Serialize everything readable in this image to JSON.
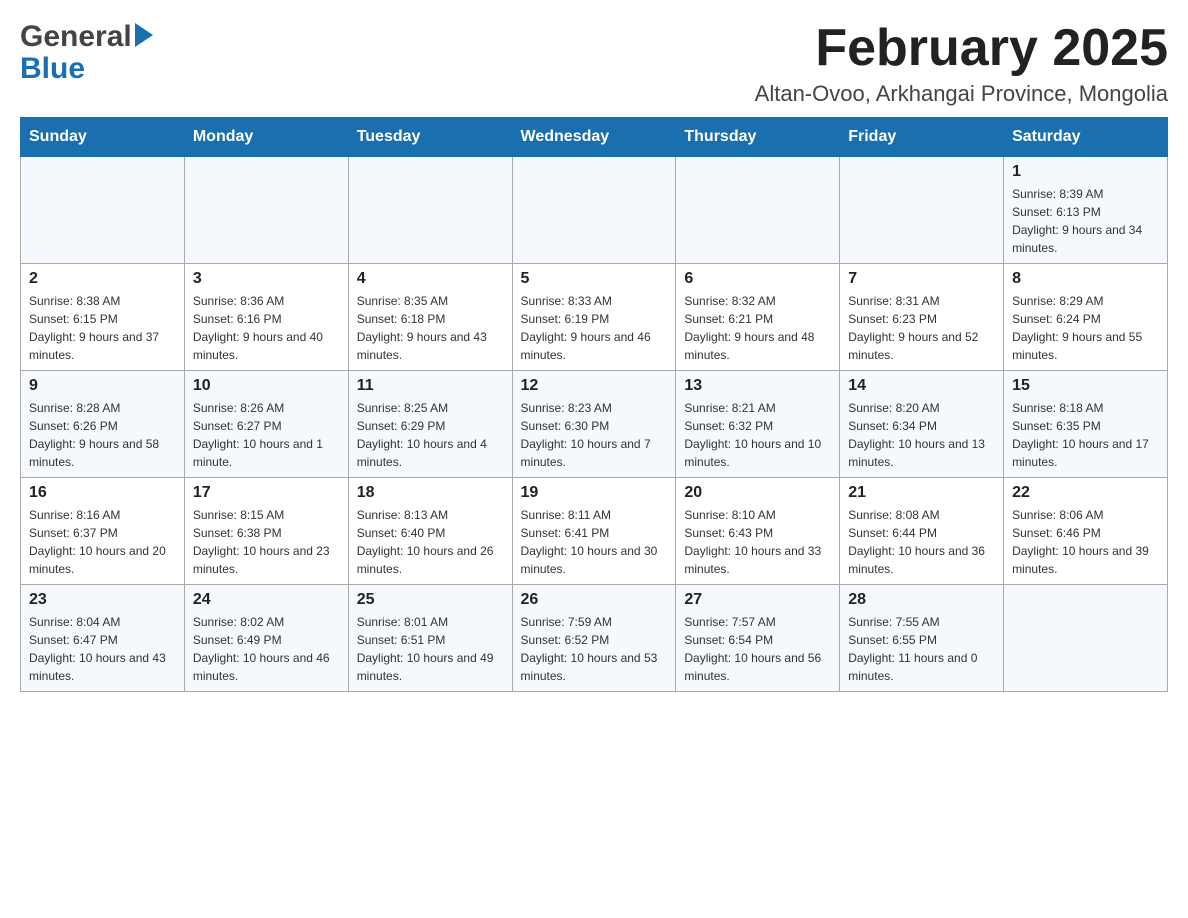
{
  "header": {
    "logo_general": "General",
    "logo_blue": "Blue",
    "month_title": "February 2025",
    "location": "Altan-Ovoo, Arkhangai Province, Mongolia"
  },
  "weekdays": [
    "Sunday",
    "Monday",
    "Tuesday",
    "Wednesday",
    "Thursday",
    "Friday",
    "Saturday"
  ],
  "weeks": [
    [
      {
        "day": "",
        "sunrise": "",
        "sunset": "",
        "daylight": ""
      },
      {
        "day": "",
        "sunrise": "",
        "sunset": "",
        "daylight": ""
      },
      {
        "day": "",
        "sunrise": "",
        "sunset": "",
        "daylight": ""
      },
      {
        "day": "",
        "sunrise": "",
        "sunset": "",
        "daylight": ""
      },
      {
        "day": "",
        "sunrise": "",
        "sunset": "",
        "daylight": ""
      },
      {
        "day": "",
        "sunrise": "",
        "sunset": "",
        "daylight": ""
      },
      {
        "day": "1",
        "sunrise": "Sunrise: 8:39 AM",
        "sunset": "Sunset: 6:13 PM",
        "daylight": "Daylight: 9 hours and 34 minutes."
      }
    ],
    [
      {
        "day": "2",
        "sunrise": "Sunrise: 8:38 AM",
        "sunset": "Sunset: 6:15 PM",
        "daylight": "Daylight: 9 hours and 37 minutes."
      },
      {
        "day": "3",
        "sunrise": "Sunrise: 8:36 AM",
        "sunset": "Sunset: 6:16 PM",
        "daylight": "Daylight: 9 hours and 40 minutes."
      },
      {
        "day": "4",
        "sunrise": "Sunrise: 8:35 AM",
        "sunset": "Sunset: 6:18 PM",
        "daylight": "Daylight: 9 hours and 43 minutes."
      },
      {
        "day": "5",
        "sunrise": "Sunrise: 8:33 AM",
        "sunset": "Sunset: 6:19 PM",
        "daylight": "Daylight: 9 hours and 46 minutes."
      },
      {
        "day": "6",
        "sunrise": "Sunrise: 8:32 AM",
        "sunset": "Sunset: 6:21 PM",
        "daylight": "Daylight: 9 hours and 48 minutes."
      },
      {
        "day": "7",
        "sunrise": "Sunrise: 8:31 AM",
        "sunset": "Sunset: 6:23 PM",
        "daylight": "Daylight: 9 hours and 52 minutes."
      },
      {
        "day": "8",
        "sunrise": "Sunrise: 8:29 AM",
        "sunset": "Sunset: 6:24 PM",
        "daylight": "Daylight: 9 hours and 55 minutes."
      }
    ],
    [
      {
        "day": "9",
        "sunrise": "Sunrise: 8:28 AM",
        "sunset": "Sunset: 6:26 PM",
        "daylight": "Daylight: 9 hours and 58 minutes."
      },
      {
        "day": "10",
        "sunrise": "Sunrise: 8:26 AM",
        "sunset": "Sunset: 6:27 PM",
        "daylight": "Daylight: 10 hours and 1 minute."
      },
      {
        "day": "11",
        "sunrise": "Sunrise: 8:25 AM",
        "sunset": "Sunset: 6:29 PM",
        "daylight": "Daylight: 10 hours and 4 minutes."
      },
      {
        "day": "12",
        "sunrise": "Sunrise: 8:23 AM",
        "sunset": "Sunset: 6:30 PM",
        "daylight": "Daylight: 10 hours and 7 minutes."
      },
      {
        "day": "13",
        "sunrise": "Sunrise: 8:21 AM",
        "sunset": "Sunset: 6:32 PM",
        "daylight": "Daylight: 10 hours and 10 minutes."
      },
      {
        "day": "14",
        "sunrise": "Sunrise: 8:20 AM",
        "sunset": "Sunset: 6:34 PM",
        "daylight": "Daylight: 10 hours and 13 minutes."
      },
      {
        "day": "15",
        "sunrise": "Sunrise: 8:18 AM",
        "sunset": "Sunset: 6:35 PM",
        "daylight": "Daylight: 10 hours and 17 minutes."
      }
    ],
    [
      {
        "day": "16",
        "sunrise": "Sunrise: 8:16 AM",
        "sunset": "Sunset: 6:37 PM",
        "daylight": "Daylight: 10 hours and 20 minutes."
      },
      {
        "day": "17",
        "sunrise": "Sunrise: 8:15 AM",
        "sunset": "Sunset: 6:38 PM",
        "daylight": "Daylight: 10 hours and 23 minutes."
      },
      {
        "day": "18",
        "sunrise": "Sunrise: 8:13 AM",
        "sunset": "Sunset: 6:40 PM",
        "daylight": "Daylight: 10 hours and 26 minutes."
      },
      {
        "day": "19",
        "sunrise": "Sunrise: 8:11 AM",
        "sunset": "Sunset: 6:41 PM",
        "daylight": "Daylight: 10 hours and 30 minutes."
      },
      {
        "day": "20",
        "sunrise": "Sunrise: 8:10 AM",
        "sunset": "Sunset: 6:43 PM",
        "daylight": "Daylight: 10 hours and 33 minutes."
      },
      {
        "day": "21",
        "sunrise": "Sunrise: 8:08 AM",
        "sunset": "Sunset: 6:44 PM",
        "daylight": "Daylight: 10 hours and 36 minutes."
      },
      {
        "day": "22",
        "sunrise": "Sunrise: 8:06 AM",
        "sunset": "Sunset: 6:46 PM",
        "daylight": "Daylight: 10 hours and 39 minutes."
      }
    ],
    [
      {
        "day": "23",
        "sunrise": "Sunrise: 8:04 AM",
        "sunset": "Sunset: 6:47 PM",
        "daylight": "Daylight: 10 hours and 43 minutes."
      },
      {
        "day": "24",
        "sunrise": "Sunrise: 8:02 AM",
        "sunset": "Sunset: 6:49 PM",
        "daylight": "Daylight: 10 hours and 46 minutes."
      },
      {
        "day": "25",
        "sunrise": "Sunrise: 8:01 AM",
        "sunset": "Sunset: 6:51 PM",
        "daylight": "Daylight: 10 hours and 49 minutes."
      },
      {
        "day": "26",
        "sunrise": "Sunrise: 7:59 AM",
        "sunset": "Sunset: 6:52 PM",
        "daylight": "Daylight: 10 hours and 53 minutes."
      },
      {
        "day": "27",
        "sunrise": "Sunrise: 7:57 AM",
        "sunset": "Sunset: 6:54 PM",
        "daylight": "Daylight: 10 hours and 56 minutes."
      },
      {
        "day": "28",
        "sunrise": "Sunrise: 7:55 AM",
        "sunset": "Sunset: 6:55 PM",
        "daylight": "Daylight: 11 hours and 0 minutes."
      },
      {
        "day": "",
        "sunrise": "",
        "sunset": "",
        "daylight": ""
      }
    ]
  ]
}
